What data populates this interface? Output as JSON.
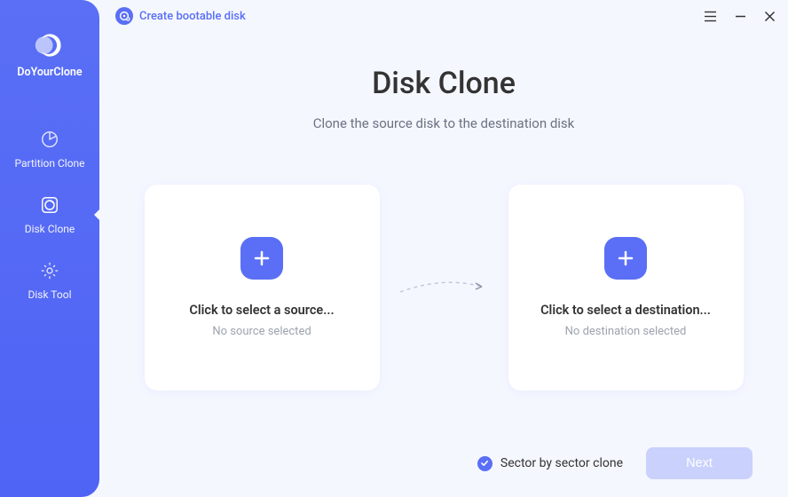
{
  "app": {
    "name": "DoYourClone"
  },
  "topbar": {
    "bootable_label": "Create bootable disk"
  },
  "sidebar": {
    "items": [
      {
        "label": "Partition Clone"
      },
      {
        "label": "Disk Clone"
      },
      {
        "label": "Disk Tool"
      }
    ]
  },
  "page": {
    "title": "Disk Clone",
    "subtitle": "Clone the source disk to the destination disk"
  },
  "source_card": {
    "title": "Click to select a source...",
    "sub": "No source selected"
  },
  "dest_card": {
    "title": "Click to select a destination...",
    "sub": "No destination selected"
  },
  "footer": {
    "sector_label": "Sector by sector clone",
    "next_label": "Next"
  }
}
